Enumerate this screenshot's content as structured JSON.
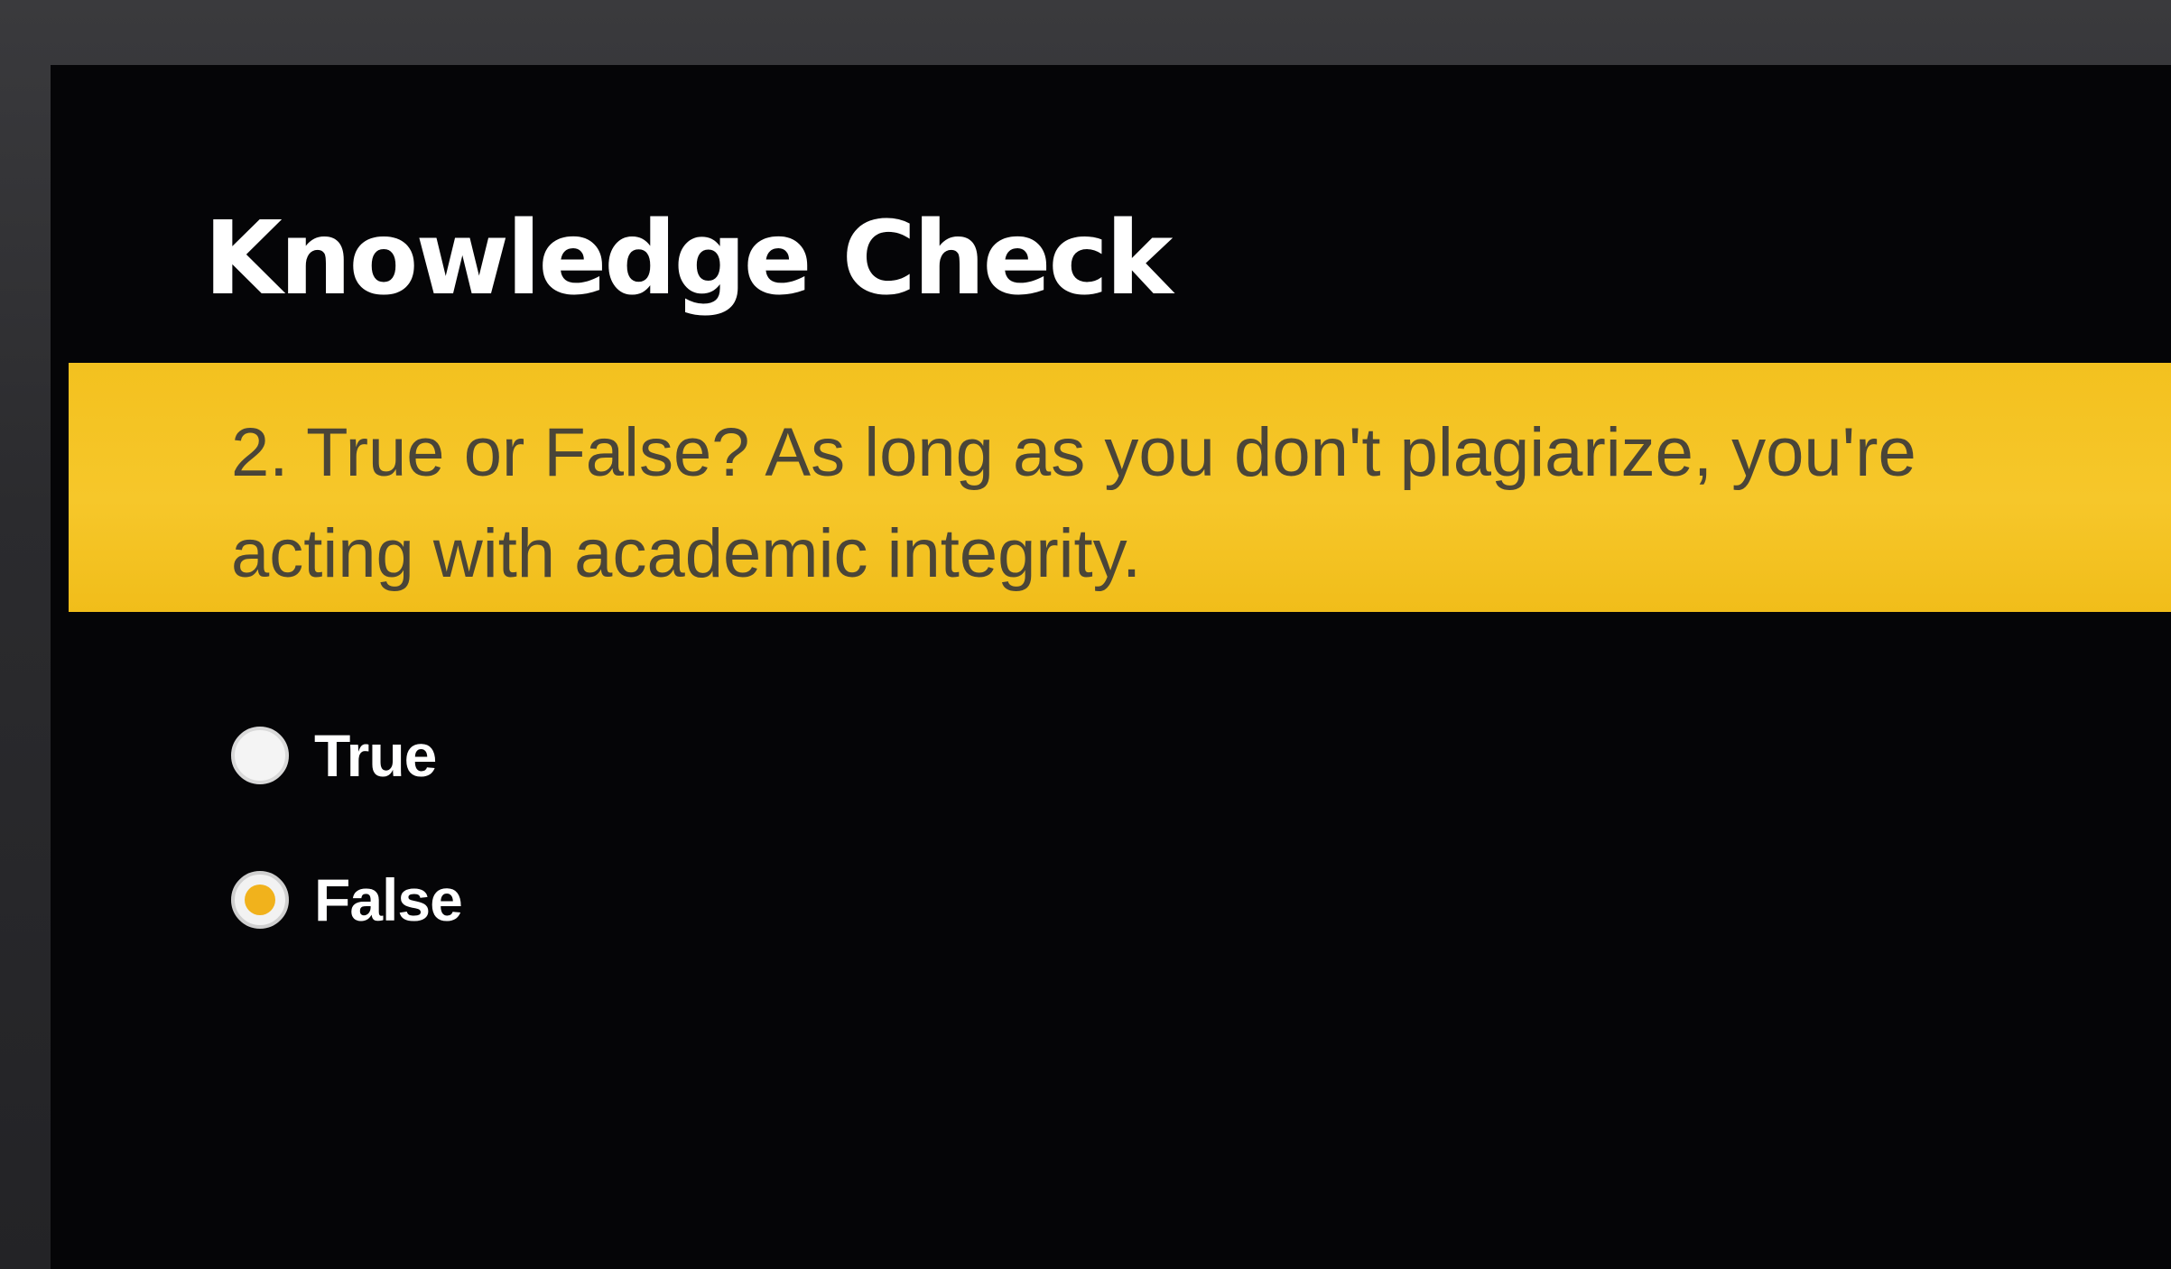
{
  "page": {
    "title": "Knowledge Check"
  },
  "question": {
    "text": "2. True or False? As long as you don't plagiarize, you're acting with academic integrity."
  },
  "options": [
    {
      "label": "True",
      "selected": false
    },
    {
      "label": "False",
      "selected": true
    }
  ],
  "colors": {
    "background": "#050507",
    "accent_band": "#f6c72a",
    "question_text": "#4a4538",
    "selected_radio": "#f1b21c",
    "title_text": "#ffffff"
  }
}
